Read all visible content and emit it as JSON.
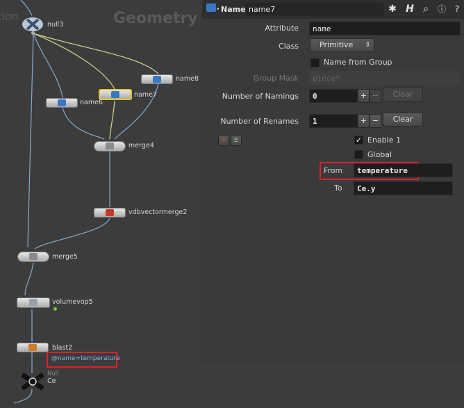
{
  "network": {
    "context_title": "Geometry",
    "context_title_prefix": "tion",
    "nodes": {
      "null3": "null3",
      "name8": "name8",
      "name7": "name7",
      "name6": "name6",
      "merge4": "merge4",
      "vdbvectormerge2": "vdbvectormerge2",
      "merge5": "merge5",
      "volumevop5": "volumevop5",
      "blast2": "blast2",
      "null_type": "Null",
      "ce": "Ce"
    },
    "blast_flag": "@name=temperature"
  },
  "header": {
    "node_type": "Name",
    "node_name": "name7",
    "icons": [
      "gear-icon",
      "help-h-icon",
      "search-icon",
      "info-icon",
      "help-icon"
    ]
  },
  "params": {
    "attribute_label": "Attribute",
    "attribute_value": "name",
    "class_label": "Class",
    "class_value": "Primitive",
    "name_from_group_label": "Name from Group",
    "group_mask_label": "Group Mask",
    "group_mask_placeholder": "piece*",
    "num_namings_label": "Number of Namings",
    "num_namings_value": "0",
    "clear_label": "Clear",
    "num_renames_label": "Number of Renames",
    "num_renames_value": "1",
    "plus": "+",
    "minus": "−",
    "enable_label": "Enable 1",
    "global_label": "Global",
    "from_label": "From",
    "from_value": "temperature",
    "to_label": "To",
    "to_value": "Ce.y"
  },
  "colors": {
    "highlight": "#e0202a",
    "selected_node": "#e6c229",
    "wire": "#7fa4c9",
    "wire_selected": "#c8d38a"
  }
}
